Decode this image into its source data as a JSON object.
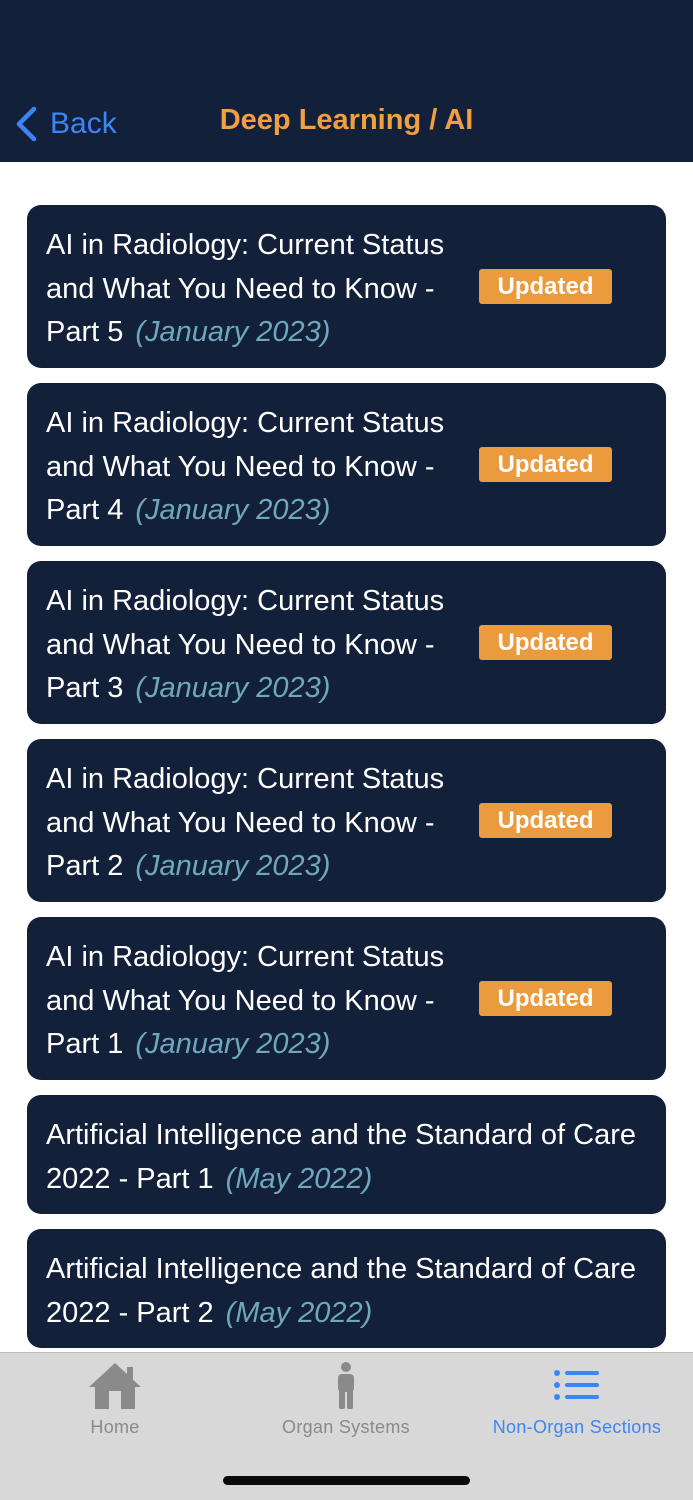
{
  "header": {
    "back_label": "Back",
    "title": "Deep Learning / AI"
  },
  "items": [
    {
      "title": "AI in Radiology: Current Status and What You Need to Know - Part 5",
      "date": "(January 2023)",
      "badge": "Updated"
    },
    {
      "title": "AI in Radiology: Current Status and What You Need to Know - Part 4",
      "date": "(January 2023)",
      "badge": "Updated"
    },
    {
      "title": "AI in Radiology: Current Status and What You Need to Know - Part 3",
      "date": "(January 2023)",
      "badge": "Updated"
    },
    {
      "title": "AI in Radiology: Current Status and What You Need to Know - Part 2",
      "date": "(January 2023)",
      "badge": "Updated"
    },
    {
      "title": "AI in Radiology: Current Status and What You Need to Know - Part 1",
      "date": "(January 2023)",
      "badge": "Updated"
    },
    {
      "title": "Artificial Intelligence and the Standard of Care 2022 - Part 1",
      "date": "(May 2022)",
      "badge": ""
    },
    {
      "title": "Artificial Intelligence and the Standard of Care 2022 - Part 2",
      "date": "(May 2022)",
      "badge": ""
    }
  ],
  "tabbar": {
    "tabs": [
      {
        "label": "Home",
        "icon": "house-icon",
        "active": false
      },
      {
        "label": "Organ Systems",
        "icon": "person-icon",
        "active": false
      },
      {
        "label": "Non-Organ Sections",
        "icon": "list-icon",
        "active": true
      }
    ]
  },
  "colors": {
    "navy": "#13203a",
    "accent_orange": "#f0a040",
    "badge_orange": "#ec9a3e",
    "link_blue": "#3b86f7",
    "date_teal": "#6fa8bc",
    "tab_bg": "#d8d8d8"
  }
}
